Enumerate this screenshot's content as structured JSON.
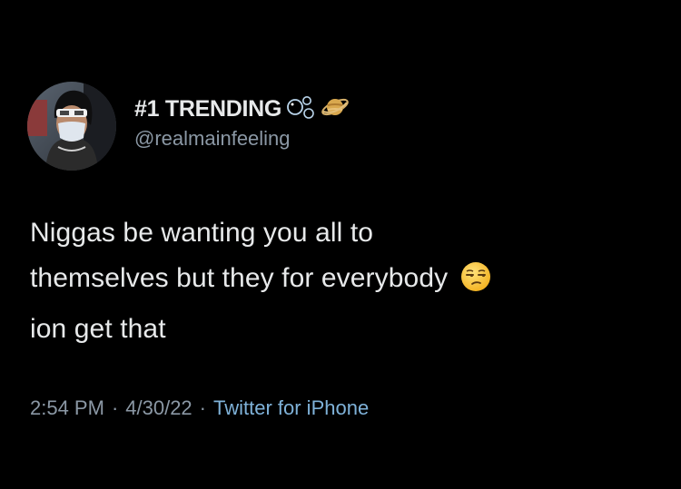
{
  "tweet": {
    "display_name": "#1 TRENDING",
    "handle": "@realmainfeeling",
    "name_icons": [
      "bubbles-icon",
      "ringed-planet-icon"
    ],
    "text_lines": [
      "Niggas be wanting you all to",
      "themselves but they for everybody",
      "ion get that"
    ],
    "emoji": "unamused-face-emoji",
    "time": "2:54 PM",
    "date": "4/30/22",
    "separator": "·",
    "source": "Twitter for iPhone"
  },
  "colors": {
    "background": "#000000",
    "primary_text": "#e7e9ea",
    "secondary_text": "#8b98a5",
    "source_link": "#7fb2d9"
  }
}
